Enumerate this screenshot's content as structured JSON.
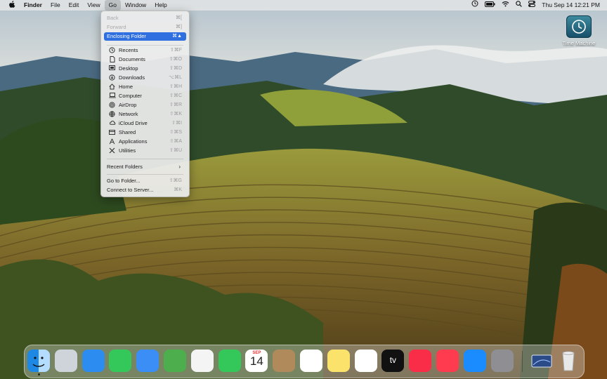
{
  "menubar": {
    "apple_icon": "apple-logo-icon",
    "app_name": "Finder",
    "menus": [
      "File",
      "Edit",
      "View",
      "Go",
      "Window",
      "Help"
    ],
    "active_menu": "Go",
    "status_icons": [
      "time-machine-icon",
      "battery-icon",
      "wifi-icon",
      "search-icon",
      "control-center-icon"
    ],
    "clock": "Thu Sep 14  12:21 PM"
  },
  "go_menu": {
    "items": [
      {
        "label": "Back",
        "shortcut": "⌘[",
        "disabled": true
      },
      {
        "label": "Forward",
        "shortcut": "⌘]",
        "disabled": true
      },
      {
        "label": "Enclosing Folder",
        "shortcut": "⌘▲",
        "selected": true
      }
    ],
    "places": [
      {
        "label": "Recents",
        "shortcut": "⇧⌘F",
        "icon": "clock-icon"
      },
      {
        "label": "Documents",
        "shortcut": "⇧⌘O",
        "icon": "document-icon"
      },
      {
        "label": "Desktop",
        "shortcut": "⇧⌘D",
        "icon": "desktop-icon"
      },
      {
        "label": "Downloads",
        "shortcut": "⌥⌘L",
        "icon": "download-icon"
      },
      {
        "label": "Home",
        "shortcut": "⇧⌘H",
        "icon": "home-icon"
      },
      {
        "label": "Computer",
        "shortcut": "⇧⌘C",
        "icon": "computer-icon"
      },
      {
        "label": "AirDrop",
        "shortcut": "⇧⌘R",
        "icon": "airdrop-icon"
      },
      {
        "label": "Network",
        "shortcut": "⇧⌘K",
        "icon": "network-icon"
      },
      {
        "label": "iCloud Drive",
        "shortcut": "⇧⌘I",
        "icon": "cloud-icon"
      },
      {
        "label": "Shared",
        "shortcut": "⇧⌘S",
        "icon": "shared-icon"
      },
      {
        "label": "Applications",
        "shortcut": "⇧⌘A",
        "icon": "applications-icon"
      },
      {
        "label": "Utilities",
        "shortcut": "⇧⌘U",
        "icon": "utilities-icon"
      }
    ],
    "recent_folders": "Recent Folders",
    "go_to_folder": {
      "label": "Go to Folder...",
      "shortcut": "⇧⌘G"
    },
    "connect_to_server": {
      "label": "Connect to Server...",
      "shortcut": "⌘K"
    }
  },
  "desktop_items": [
    {
      "label": "Time Machine",
      "icon": "time-machine-disk-icon"
    }
  ],
  "dock": {
    "apps": [
      {
        "name": "finder-icon",
        "color": "#1e88e5"
      },
      {
        "name": "launchpad-icon",
        "color": "#cfd3da"
      },
      {
        "name": "safari-icon",
        "color": "#2d8cf0"
      },
      {
        "name": "messages-icon",
        "color": "#34c759"
      },
      {
        "name": "mail-icon",
        "color": "#3a8ef6"
      },
      {
        "name": "maps-icon",
        "color": "#4cae4c"
      },
      {
        "name": "photos-icon",
        "color": "#f4f4f4"
      },
      {
        "name": "facetime-icon",
        "color": "#34c759"
      },
      {
        "name": "calendar-icon",
        "color": "#ffffff",
        "month": "SEP",
        "day": "14"
      },
      {
        "name": "contacts-icon",
        "color": "#b08a5a"
      },
      {
        "name": "reminders-icon",
        "color": "#ffffff"
      },
      {
        "name": "notes-icon",
        "color": "#fbe36b"
      },
      {
        "name": "freeform-icon",
        "color": "#ffffff"
      },
      {
        "name": "apple-tv-icon",
        "color": "#111111",
        "label": "tv"
      },
      {
        "name": "music-icon",
        "color": "#fa2d48"
      },
      {
        "name": "news-icon",
        "color": "#ff3b4f"
      },
      {
        "name": "app-store-icon",
        "color": "#1a8cff"
      },
      {
        "name": "system-settings-icon",
        "color": "#8e8e93"
      },
      {
        "name": "downloads-stack-icon",
        "color": "#2a4b88"
      },
      {
        "name": "trash-icon",
        "color": "#e6e6e6"
      }
    ]
  }
}
